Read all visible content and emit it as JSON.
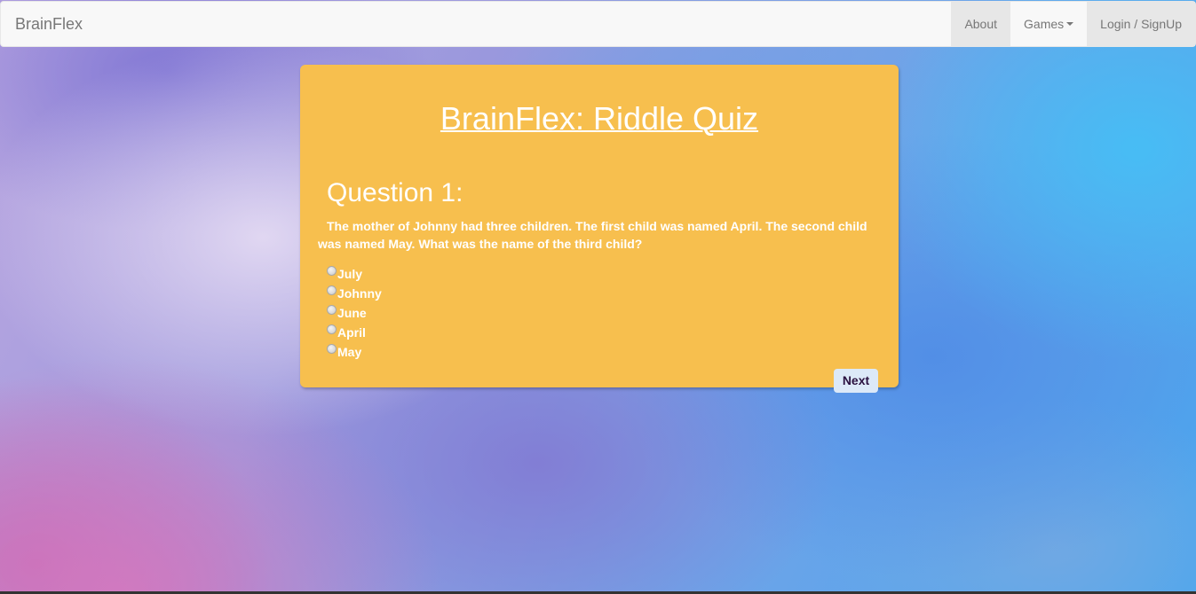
{
  "navbar": {
    "brand": "BrainFlex",
    "items": [
      {
        "label": "About"
      },
      {
        "label": "Games"
      },
      {
        "label": "Login / SignUp"
      }
    ]
  },
  "quiz": {
    "title": "BrainFlex: Riddle Quiz",
    "question_heading": "Question 1:",
    "question_text": "The mother of Johnny had three children. The first child was named April. The second child was named May. What was the name of the third child?",
    "options": [
      {
        "label": "July",
        "selected": false
      },
      {
        "label": "Johnny",
        "selected": false
      },
      {
        "label": "June",
        "selected": false
      },
      {
        "label": "April",
        "selected": false
      },
      {
        "label": "May",
        "selected": false
      }
    ],
    "next_label": "Next"
  },
  "colors": {
    "card_background": "#f7bf4e",
    "navbar_background": "#f8f8f8",
    "next_button_background": "#dce9f8"
  }
}
